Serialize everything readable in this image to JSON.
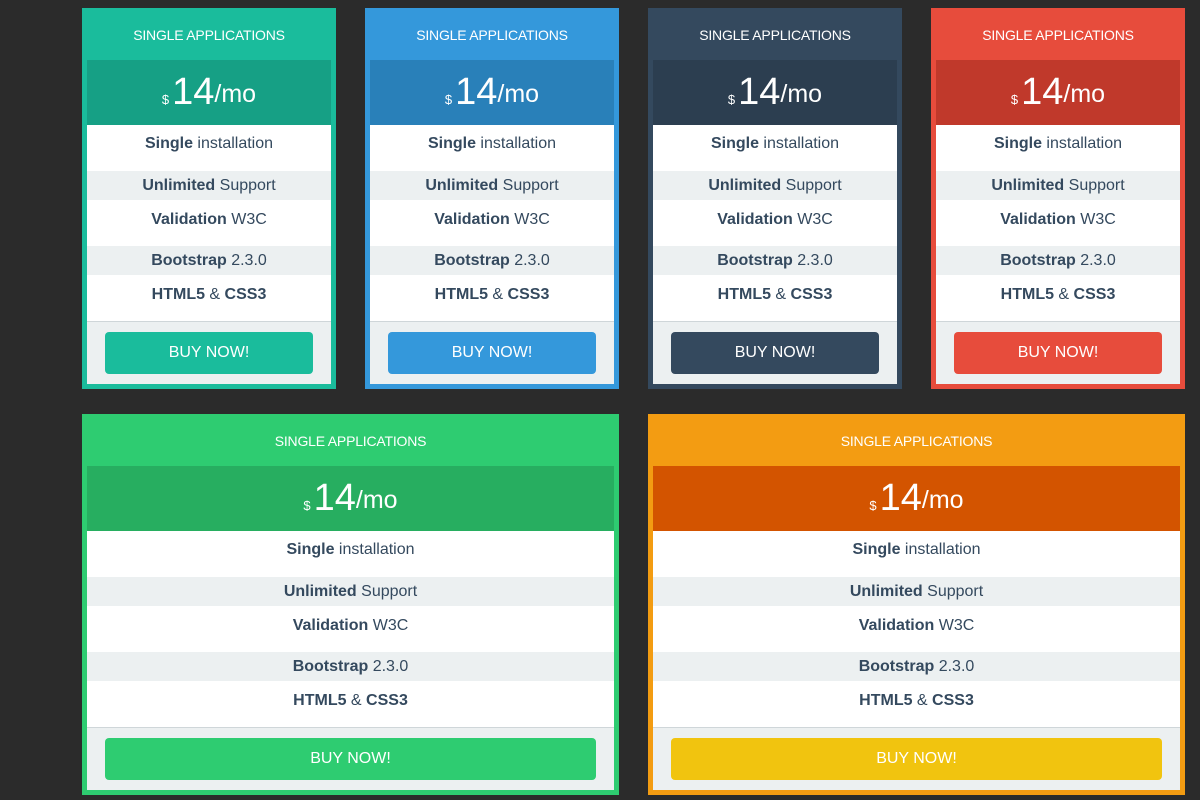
{
  "plans": [
    {
      "title": "SINGLE APPLICATIONS",
      "currency": "$",
      "amount": "14",
      "period": "/mo",
      "features": [
        {
          "bold": "Single",
          "rest": " installation"
        },
        {
          "bold": "Unlimited",
          "rest": " Support"
        },
        {
          "bold": "Validation",
          "rest": " W3C"
        },
        {
          "bold": "Bootstrap",
          "rest": " 2.3.0"
        },
        {
          "bold": "HTML5",
          "rest": " & ",
          "bold2": "CSS3"
        }
      ],
      "button": "BUY NOW!",
      "theme": "teal",
      "color": "#1abc9c"
    },
    {
      "title": "SINGLE APPLICATIONS",
      "currency": "$",
      "amount": "14",
      "period": "/mo",
      "features": [
        {
          "bold": "Single",
          "rest": " installation"
        },
        {
          "bold": "Unlimited",
          "rest": " Support"
        },
        {
          "bold": "Validation",
          "rest": " W3C"
        },
        {
          "bold": "Bootstrap",
          "rest": " 2.3.0"
        },
        {
          "bold": "HTML5",
          "rest": " & ",
          "bold2": "CSS3"
        }
      ],
      "button": "BUY NOW!",
      "theme": "blue",
      "color": "#3498db"
    },
    {
      "title": "SINGLE APPLICATIONS",
      "currency": "$",
      "amount": "14",
      "period": "/mo",
      "features": [
        {
          "bold": "Single",
          "rest": " installation"
        },
        {
          "bold": "Unlimited",
          "rest": " Support"
        },
        {
          "bold": "Validation",
          "rest": " W3C"
        },
        {
          "bold": "Bootstrap",
          "rest": " 2.3.0"
        },
        {
          "bold": "HTML5",
          "rest": " & ",
          "bold2": "CSS3"
        }
      ],
      "button": "BUY NOW!",
      "theme": "navy",
      "color": "#34495e"
    },
    {
      "title": "SINGLE APPLICATIONS",
      "currency": "$",
      "amount": "14",
      "period": "/mo",
      "features": [
        {
          "bold": "Single",
          "rest": " installation"
        },
        {
          "bold": "Unlimited",
          "rest": " Support"
        },
        {
          "bold": "Validation",
          "rest": " W3C"
        },
        {
          "bold": "Bootstrap",
          "rest": " 2.3.0"
        },
        {
          "bold": "HTML5",
          "rest": " & ",
          "bold2": "CSS3"
        }
      ],
      "button": "BUY NOW!",
      "theme": "red",
      "color": "#e74c3c"
    },
    {
      "title": "SINGLE APPLICATIONS",
      "currency": "$",
      "amount": "14",
      "period": "/mo",
      "features": [
        {
          "bold": "Single",
          "rest": " installation"
        },
        {
          "bold": "Unlimited",
          "rest": " Support"
        },
        {
          "bold": "Validation",
          "rest": " W3C"
        },
        {
          "bold": "Bootstrap",
          "rest": " 2.3.0"
        },
        {
          "bold": "HTML5",
          "rest": " & ",
          "bold2": "CSS3"
        }
      ],
      "button": "BUY NOW!",
      "theme": "green",
      "color": "#2ecc71"
    },
    {
      "title": "SINGLE APPLICATIONS",
      "currency": "$",
      "amount": "14",
      "period": "/mo",
      "features": [
        {
          "bold": "Single",
          "rest": " installation"
        },
        {
          "bold": "Unlimited",
          "rest": " Support"
        },
        {
          "bold": "Validation",
          "rest": " W3C"
        },
        {
          "bold": "Bootstrap",
          "rest": " 2.3.0"
        },
        {
          "bold": "HTML5",
          "rest": " & ",
          "bold2": "CSS3"
        }
      ],
      "button": "BUY NOW!",
      "theme": "orange",
      "color": "#f39c12"
    }
  ]
}
